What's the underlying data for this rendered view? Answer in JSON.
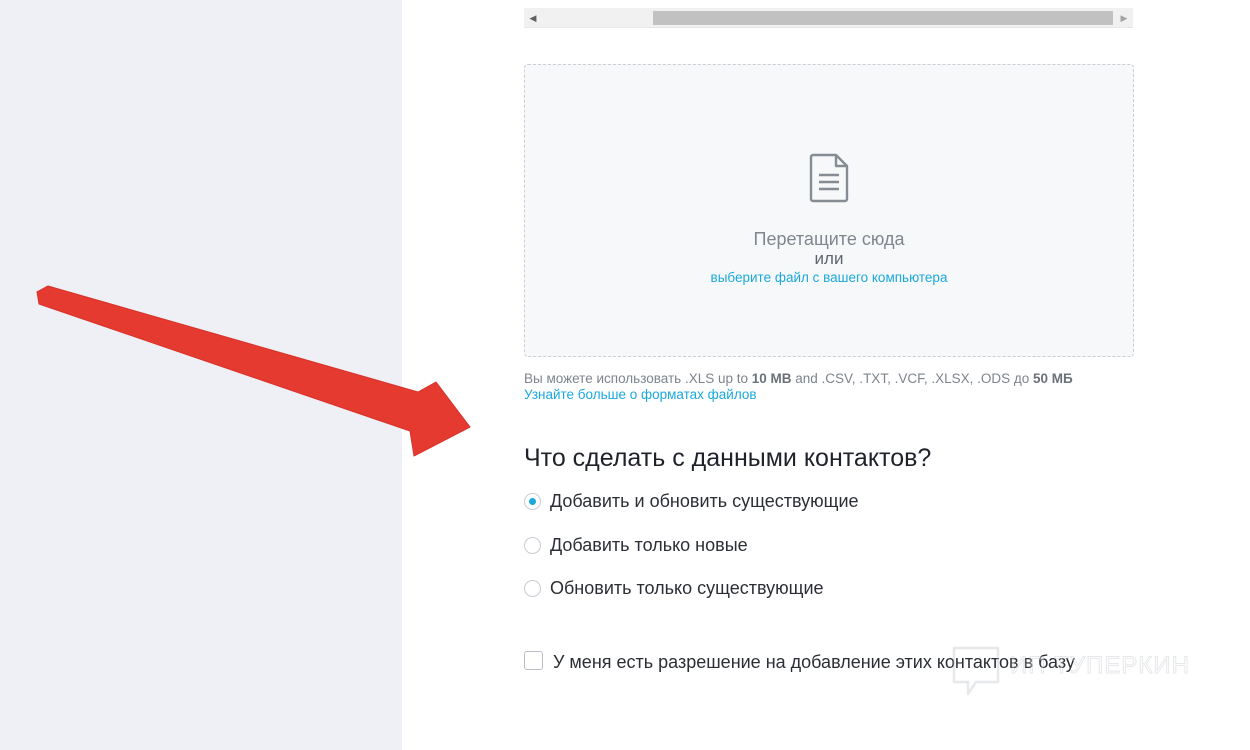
{
  "scrollbar": {
    "left_arrow": "◀",
    "right_arrow": "▶"
  },
  "dropzone": {
    "icon": "document-icon",
    "title": "Перетащите сюда",
    "or_text": "или",
    "browse_link": "выберите файл с вашего компьютера"
  },
  "hint": {
    "text_1": "Вы можете использовать .XLS up to ",
    "size_1": "10 MB",
    "text_2": " and .CSV, .TXT, .VCF, .XLSX, .ODS до ",
    "size_2": "50 МБ",
    "learn_more": "Узнайте больше о форматах файлов"
  },
  "contacts_action": {
    "title": "Что сделать с данными контактов?",
    "options": [
      {
        "label": "Добавить и обновить существующие",
        "selected": true
      },
      {
        "label": "Добавить только новые",
        "selected": false
      },
      {
        "label": "Обновить только существующие",
        "selected": false
      }
    ]
  },
  "permission": {
    "label": "У меня есть разрешение на добавление этих контактов в базу",
    "checked": false
  },
  "watermark": {
    "text": "ИП ТУПЕРКИН"
  },
  "colors": {
    "accent": "#1ba8dc",
    "sidebar_bg": "#eef0f5",
    "annotation_arrow": "#e53a2f"
  }
}
